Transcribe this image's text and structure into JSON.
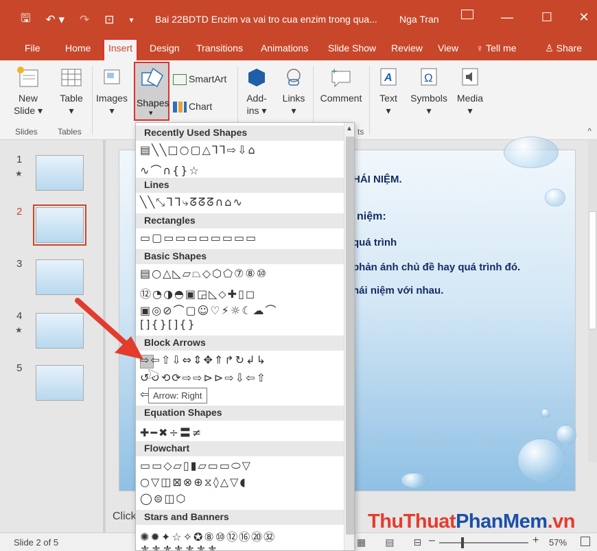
{
  "window": {
    "doc_title": "Bai 22BDTD Enzim va vai tro cua enzim trong qua...",
    "user": "Nga Tran",
    "min_glyph": "—",
    "max_glyph": "☐",
    "close_glyph": "✕"
  },
  "qat": {
    "save_glyph": "🖫",
    "undo_glyph": "↶ ▾",
    "redo_glyph": "↷",
    "present_glyph": "⊡",
    "more_glyph": "▾"
  },
  "tabs": [
    {
      "label": "File"
    },
    {
      "label": "Home"
    },
    {
      "label": "Insert"
    },
    {
      "label": "Design"
    },
    {
      "label": "Transitions"
    },
    {
      "label": "Animations"
    },
    {
      "label": "Slide Show"
    },
    {
      "label": "Review"
    },
    {
      "label": "View"
    },
    {
      "label": "♀ Tell me"
    }
  ],
  "share_label": "♙ Share",
  "ribbon": {
    "new_slide": "New Slide ▾",
    "table": "Table",
    "images": "Images",
    "shapes": "Shapes",
    "smartart": "SmartArt",
    "chart": "Chart",
    "addins": "Add-ins ▾",
    "links": "Links",
    "comment": "Comment",
    "text": "Text",
    "symbols": "Symbols",
    "media": "Media",
    "caret": "▾",
    "collapse": "^",
    "groups": {
      "slides": "Slides",
      "tables": "Tables",
      "comments_tail": "ts"
    }
  },
  "thumbnails": [
    {
      "num": "1",
      "star": "★"
    },
    {
      "num": "2",
      "star": ""
    },
    {
      "num": "3",
      "star": ""
    },
    {
      "num": "4",
      "star": "★"
    },
    {
      "num": "5",
      "star": ""
    }
  ],
  "slide_text": {
    "line1": "HÁI NIỆM.",
    "line2": "niệm:",
    "line3": "quá trình",
    "line4": "phản ánh chủ đề hay quá trình đó.",
    "line5": "hái niệm với nhau."
  },
  "notes_hint": "Click",
  "status": {
    "slide_of": "Slide 2 of 5",
    "zoom": "57%",
    "zoom_level": 0.57,
    "minus": "–",
    "plus": "+"
  },
  "dropdown": {
    "sections": {
      "recent": "Recently Used Shapes",
      "lines": "Lines",
      "rectangles": "Rectangles",
      "basic": "Basic Shapes",
      "block_arrows": "Block Arrows",
      "equation": "Equation Shapes",
      "flowchart": "Flowchart",
      "stars": "Stars and Banners"
    },
    "rows": {
      "recent_1": "▤╲╲□○▢△⅂⅂⇨⇩⌂",
      "recent_2": "∿⌒∩{}☆",
      "lines_1": "╲╲⤡ᒣᒣ⤷ᘔᘔᘔ∩⌂∿",
      "rect_1": "▭▢▭▭▭▭▭▭▭▭",
      "basic_1": "▤○△◺▱⏢◇⬡⬠⑦⑧⑩",
      "basic_2": "⑫◔◑◓▣◲◺⬦✚▯◻",
      "basic_3": "▣◎⊘⌒▢☺♡⚡☼☾☁⌒",
      "basic_4": "[]{}[]{}",
      "arrows_1": "⇨⇦⇧⇩⇔⇕✥⇑↱↻↲↳",
      "arrows_2": "↺↻⟲⟳⇨⇨⊳⊳⇨⇩⇦⇧",
      "arrows_3": "⇦",
      "eq_1": "✚━✖÷〓≠",
      "flow_1": "▭▭◇▱▯▮▱▭▭⬭▽",
      "flow_2": "○▽◫⊠⊗⊕⧖◊△▽◖",
      "flow_3": "◯⊜◫⬡",
      "stars_1": "✺✹✦☆✧✪⑧⑩⑫⑯⑳㉜",
      "stars_2": "⚜⚜⚜⚜⚜⚜⚜"
    },
    "tooltip": "Arrow: Right",
    "scroll_up": "▲"
  },
  "watermark": {
    "a": "ThuThuat",
    "b": "PhanMem",
    "c": ".vn"
  }
}
